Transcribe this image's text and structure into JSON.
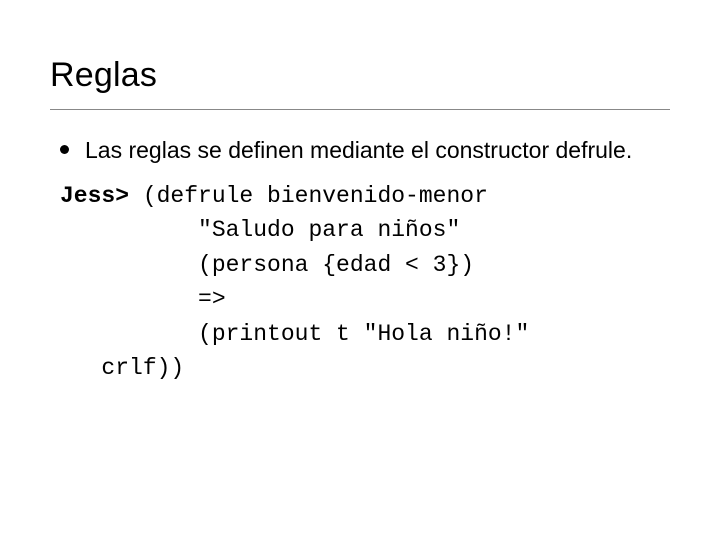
{
  "title": "Reglas",
  "bullet": "Las reglas se definen mediante el constructor defrule.",
  "code": {
    "prompt": "Jess>",
    "l1": " (defrule bienvenido-menor",
    "l2": "          \"Saludo para niños\"",
    "l3": "          (persona {edad < 3})",
    "l4": "          =>",
    "l5": "          (printout t \"Hola niño!\"",
    "l6": "   crlf))"
  }
}
